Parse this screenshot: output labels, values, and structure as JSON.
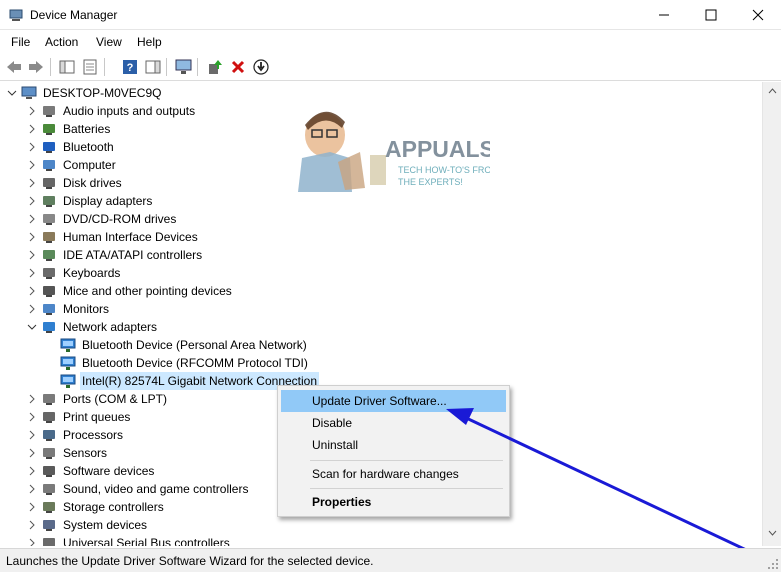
{
  "window": {
    "title": "Device Manager",
    "controls": [
      "minimize",
      "maximize",
      "close"
    ]
  },
  "menu": [
    "File",
    "Action",
    "View",
    "Help"
  ],
  "toolbar": [
    "back",
    "forward",
    "properties",
    "details",
    "help",
    "action-pane",
    "scan",
    "update-driver",
    "uninstall",
    "download"
  ],
  "tree": {
    "root": "DESKTOP-M0VEC9Q",
    "categories": [
      {
        "label": "Audio inputs and outputs",
        "icon": "speaker-icon",
        "expanded": false
      },
      {
        "label": "Batteries",
        "icon": "battery-icon",
        "expanded": false
      },
      {
        "label": "Bluetooth",
        "icon": "bluetooth-icon",
        "expanded": false
      },
      {
        "label": "Computer",
        "icon": "monitor-icon",
        "expanded": false
      },
      {
        "label": "Disk drives",
        "icon": "disk-icon",
        "expanded": false
      },
      {
        "label": "Display adapters",
        "icon": "display-adapter-icon",
        "expanded": false
      },
      {
        "label": "DVD/CD-ROM drives",
        "icon": "dvd-icon",
        "expanded": false
      },
      {
        "label": "Human Interface Devices",
        "icon": "hid-icon",
        "expanded": false
      },
      {
        "label": "IDE ATA/ATAPI controllers",
        "icon": "controller-icon",
        "expanded": false
      },
      {
        "label": "Keyboards",
        "icon": "keyboard-icon",
        "expanded": false
      },
      {
        "label": "Mice and other pointing devices",
        "icon": "mouse-icon",
        "expanded": false
      },
      {
        "label": "Monitors",
        "icon": "monitor-icon",
        "expanded": false
      },
      {
        "label": "Network adapters",
        "icon": "network-icon",
        "expanded": true
      },
      {
        "label": "Ports (COM & LPT)",
        "icon": "port-icon",
        "expanded": false
      },
      {
        "label": "Print queues",
        "icon": "printer-icon",
        "expanded": false
      },
      {
        "label": "Processors",
        "icon": "cpu-icon",
        "expanded": false
      },
      {
        "label": "Sensors",
        "icon": "sensor-icon",
        "expanded": false
      },
      {
        "label": "Software devices",
        "icon": "software-icon",
        "expanded": false
      },
      {
        "label": "Sound, video and game controllers",
        "icon": "speaker-icon",
        "expanded": false
      },
      {
        "label": "Storage controllers",
        "icon": "storage-icon",
        "expanded": false
      },
      {
        "label": "System devices",
        "icon": "system-icon",
        "expanded": false
      },
      {
        "label": "Universal Serial Bus controllers",
        "icon": "usb-icon",
        "expanded": false
      }
    ],
    "network_children": [
      "Bluetooth Device (Personal Area Network)",
      "Bluetooth Device (RFCOMM Protocol TDI)",
      "Intel(R) 82574L Gigabit Network Connection"
    ],
    "selected": "Intel(R) 82574L Gigabit Network Connection"
  },
  "context_menu": {
    "items": [
      {
        "label": "Update Driver Software...",
        "highlighted": true,
        "bold": false
      },
      {
        "label": "Disable",
        "highlighted": false,
        "bold": false
      },
      {
        "label": "Uninstall",
        "highlighted": false,
        "bold": false
      },
      {
        "label": "Scan for hardware changes",
        "highlighted": false,
        "bold": false
      },
      {
        "label": "Properties",
        "highlighted": false,
        "bold": true
      }
    ]
  },
  "watermark": {
    "brand": "APPUALS",
    "tagline_1": "TECH HOW-TO'S FROM",
    "tagline_2": "THE EXPERTS!"
  },
  "status": {
    "text": "Launches the Update Driver Software Wizard for the selected device."
  },
  "colors": {
    "selection": "#cce8ff",
    "menu_highlight": "#91c9f7",
    "arrow": "#1a1ad6",
    "network_icon": "#2f7fd0"
  }
}
